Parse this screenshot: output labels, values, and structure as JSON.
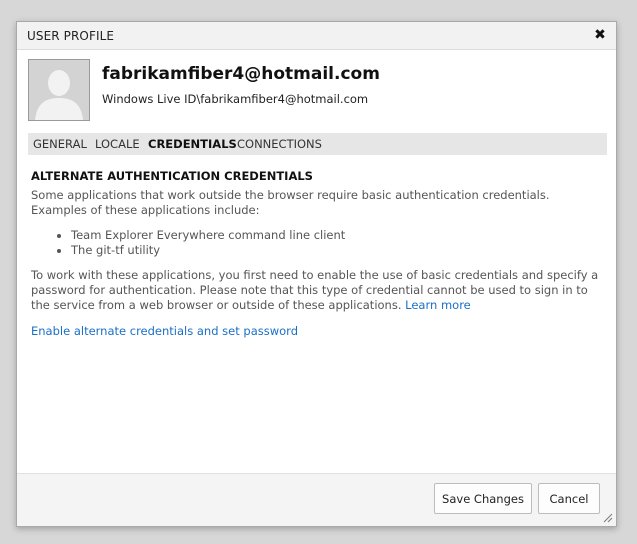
{
  "dialog": {
    "title": "USER PROFILE",
    "close_icon": "close-icon"
  },
  "user": {
    "name": "fabrikamfiber4@hotmail.com",
    "id": "Windows Live ID\\fabrikamfiber4@hotmail.com",
    "avatar_icon": "default-avatar-silhouette"
  },
  "tabs": [
    {
      "label": "GENERAL",
      "active": false
    },
    {
      "label": "LOCALE",
      "active": false
    },
    {
      "label": "CREDENTIALS",
      "active": true
    },
    {
      "label": "CONNECTIONS",
      "active": false
    }
  ],
  "credentials": {
    "heading": "ALTERNATE AUTHENTICATION CREDENTIALS",
    "intro": "Some applications that work outside the browser require basic authentication credentials. Examples of these applications include:",
    "examples": [
      "Team Explorer Everywhere command line client",
      "The git-tf utility"
    ],
    "note": "To work with these applications, you first need to enable the use of basic credentials and specify a password for authentication. Please note that this type of credential cannot be used to sign in to the service from a web browser or outside of these applications.",
    "learn_more": "Learn more",
    "enable_link": "Enable alternate credentials and set password"
  },
  "footer": {
    "save_label": "Save Changes",
    "cancel_label": "Cancel"
  },
  "colors": {
    "link": "#1a6fc7",
    "tab_bar": "#e6e6e6",
    "title_bar": "#f2f2f2"
  }
}
